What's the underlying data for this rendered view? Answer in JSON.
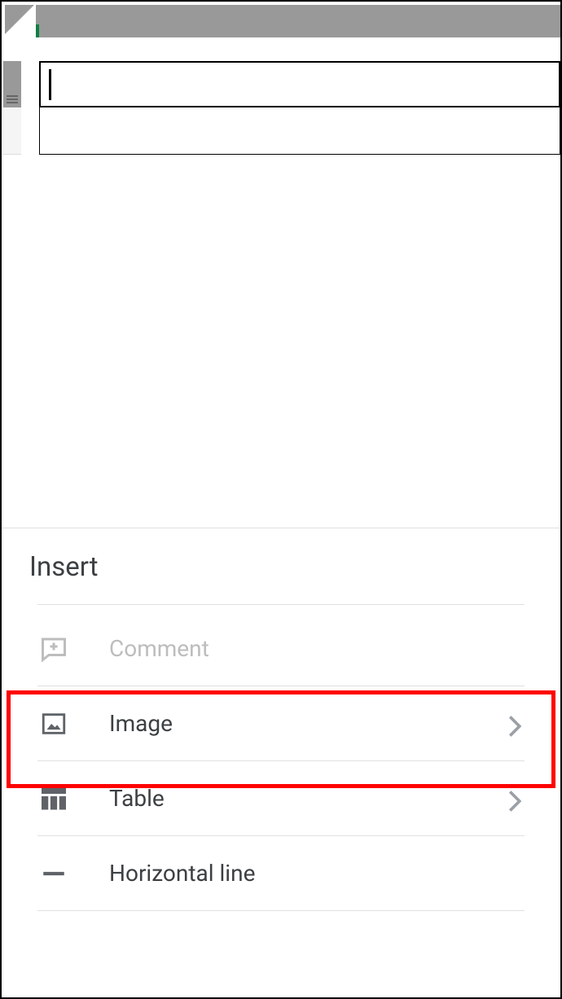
{
  "sheet": {
    "title": "Insert",
    "items": [
      {
        "id": "comment",
        "label": "Comment",
        "disabled": true,
        "chevron": false
      },
      {
        "id": "image",
        "label": "Image",
        "disabled": false,
        "chevron": true
      },
      {
        "id": "table",
        "label": "Table",
        "disabled": false,
        "chevron": true
      },
      {
        "id": "horizontal-line",
        "label": "Horizontal line",
        "disabled": false,
        "chevron": false
      }
    ]
  }
}
